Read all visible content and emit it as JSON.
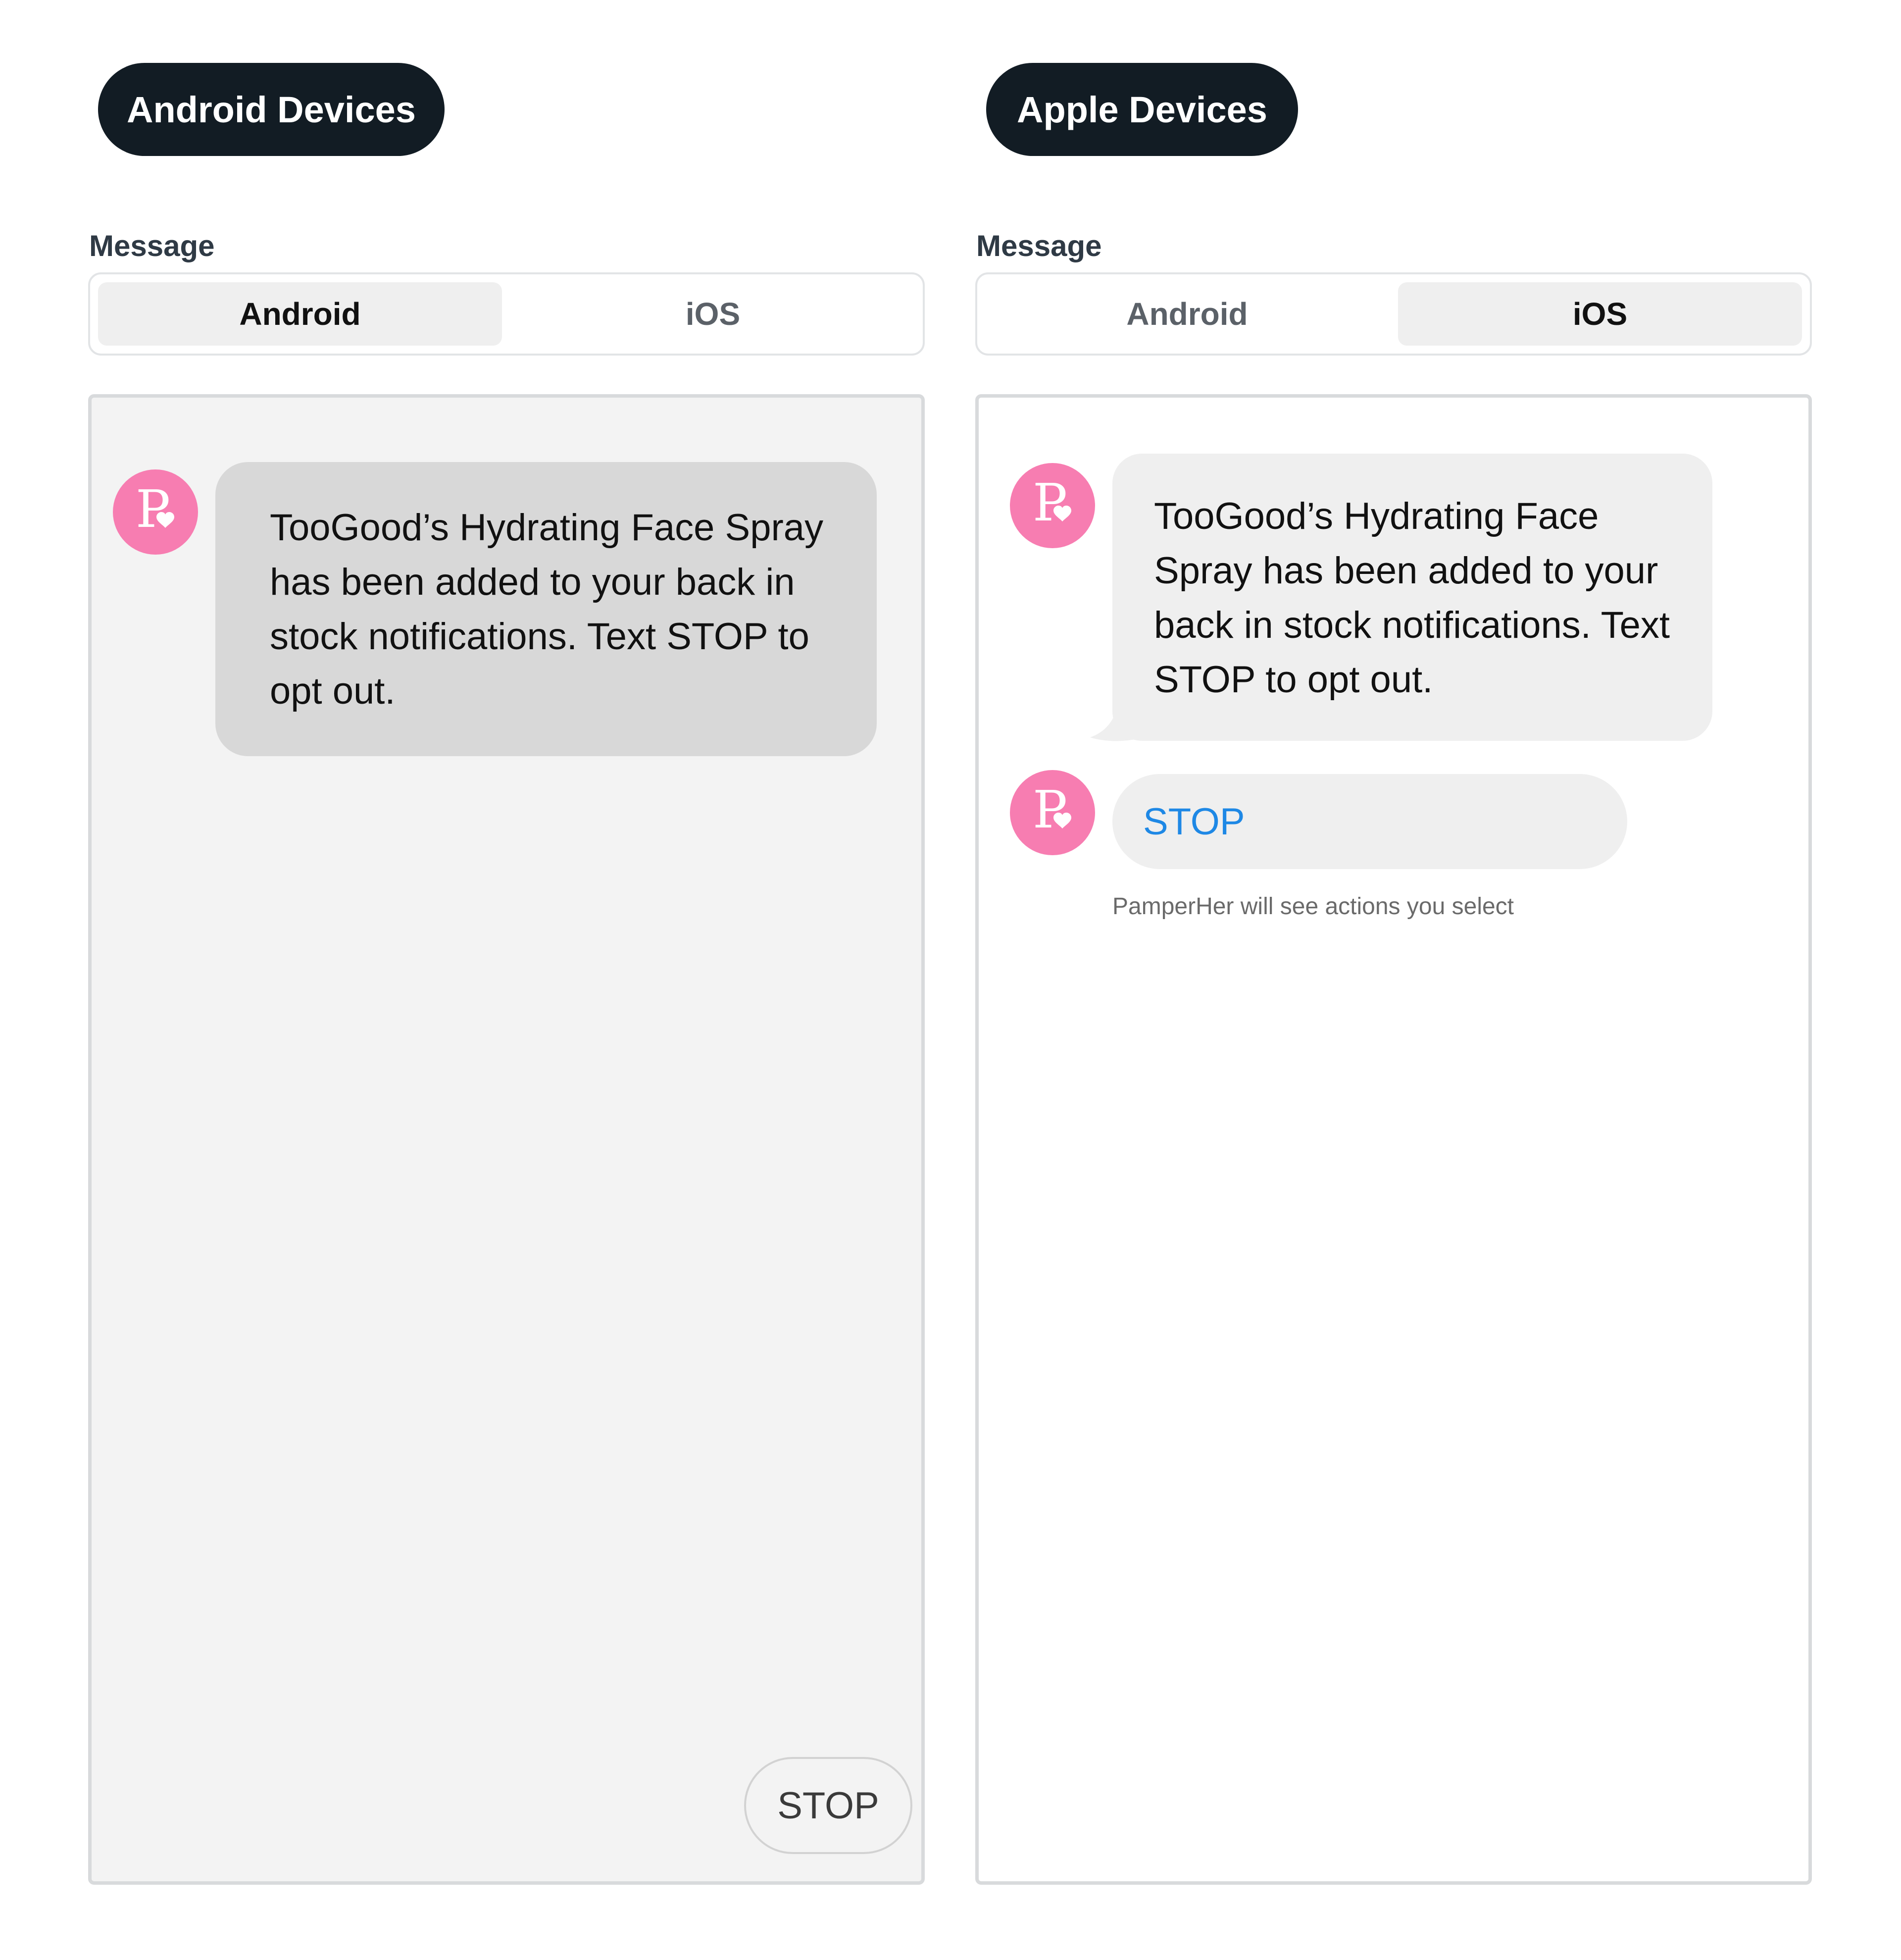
{
  "brand": {
    "name": "PamperHer",
    "avatar_letter": "P",
    "avatar_color": "#f77db1"
  },
  "android_panel": {
    "heading": "Android Devices",
    "message_label": "Message",
    "tabs": [
      {
        "label": "Android",
        "active": true
      },
      {
        "label": "iOS",
        "active": false
      }
    ],
    "message_text": "TooGood’s Hydrating Face Spray has been added to your back in stock notifications. Text STOP to opt out.",
    "reply_chip": "STOP"
  },
  "ios_panel": {
    "heading": "Apple Devices",
    "message_label": "Message",
    "tabs": [
      {
        "label": "Android",
        "active": false
      },
      {
        "label": "iOS",
        "active": true
      }
    ],
    "message_text": "TooGood’s Hydrating Face Spray has been added to your back in stock notifications. Text STOP to opt out.",
    "action_label": "STOP",
    "action_caption": "PamperHer will see actions you select"
  },
  "colors": {
    "heading_pill_bg": "#121c24",
    "active_tab_bg": "#efefef",
    "android_bubble_bg": "#d8d8d8",
    "ios_bubble_bg": "#efefef",
    "ios_action_text": "#1e88e5"
  }
}
